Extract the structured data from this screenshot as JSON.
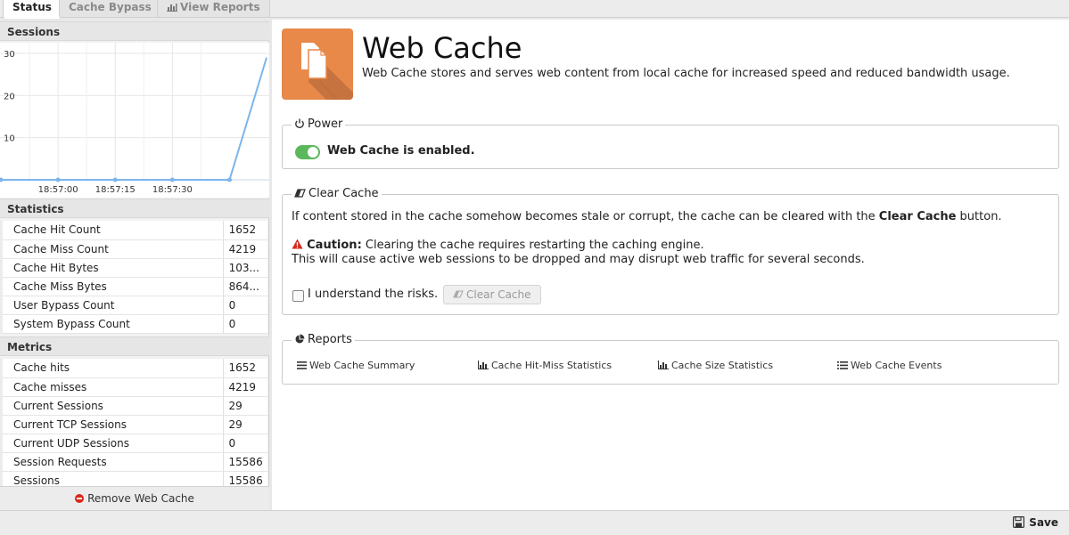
{
  "tabs": [
    {
      "label": "Status",
      "active": true
    },
    {
      "label": "Cache Bypass",
      "active": false
    },
    {
      "label": "View Reports",
      "active": false,
      "icon": "bar-chart-icon"
    }
  ],
  "sidebar": {
    "sessions_title": "Sessions",
    "chart_data": {
      "type": "line",
      "x": [
        "18:56:45",
        "18:56:52",
        "18:57:00",
        "18:57:07",
        "18:57:15",
        "18:57:22",
        "18:57:30",
        "18:57:37",
        "18:57:45",
        "18:57:48"
      ],
      "y_ticks": [
        "30",
        "20",
        "10"
      ],
      "x_ticks": [
        "18:57:00",
        "18:57:15",
        "18:57:30"
      ],
      "values": [
        0,
        0,
        0,
        0,
        0,
        0,
        0,
        0,
        0,
        29
      ],
      "ylim": [
        0,
        30
      ],
      "color": "#7cb5ec"
    },
    "statistics_title": "Statistics",
    "statistics": [
      {
        "k": "Cache Hit Count",
        "v": "1652"
      },
      {
        "k": "Cache Miss Count",
        "v": "4219"
      },
      {
        "k": "Cache Hit Bytes",
        "v": "103..."
      },
      {
        "k": "Cache Miss Bytes",
        "v": "864..."
      },
      {
        "k": "User Bypass Count",
        "v": "0"
      },
      {
        "k": "System Bypass Count",
        "v": "0"
      }
    ],
    "metrics_title": "Metrics",
    "metrics": [
      {
        "k": "Cache hits",
        "v": "1652"
      },
      {
        "k": "Cache misses",
        "v": "4219"
      },
      {
        "k": "Current Sessions",
        "v": "29"
      },
      {
        "k": "Current TCP Sessions",
        "v": "29"
      },
      {
        "k": "Current UDP Sessions",
        "v": "0"
      },
      {
        "k": "Session Requests",
        "v": "15586"
      },
      {
        "k": "Sessions",
        "v": "15586"
      }
    ],
    "remove_label": "Remove Web Cache"
  },
  "main": {
    "title": "Web Cache",
    "description": "Web Cache stores and serves web content from local cache for increased speed and reduced bandwidth usage.",
    "power": {
      "legend": "Power",
      "status": "Web Cache is enabled.",
      "enabled": true,
      "accent": "#5cb85c"
    },
    "clear_cache": {
      "legend": "Clear Cache",
      "intro_pre": "If content stored in the cache somehow becomes stale or corrupt, the cache can be cleared with the ",
      "intro_bold": "Clear Cache",
      "intro_post": " button.",
      "caution_label": "Caution:",
      "caution_text": " Clearing the cache requires restarting the caching engine.",
      "caution_line2": "This will cause active web sessions to be dropped and may disrupt web traffic for several seconds.",
      "checkbox_label": "I understand the risks.",
      "button_label": "Clear Cache"
    },
    "reports": {
      "legend": "Reports",
      "links": [
        {
          "label": "Web Cache Summary",
          "icon": "list-icon"
        },
        {
          "label": "Cache Hit-Miss Statistics",
          "icon": "bar-chart-icon"
        },
        {
          "label": "Cache Size Statistics",
          "icon": "bar-chart-icon"
        },
        {
          "label": "Web Cache Events",
          "icon": "list-icon"
        }
      ]
    }
  },
  "footer": {
    "save_label": "Save"
  }
}
